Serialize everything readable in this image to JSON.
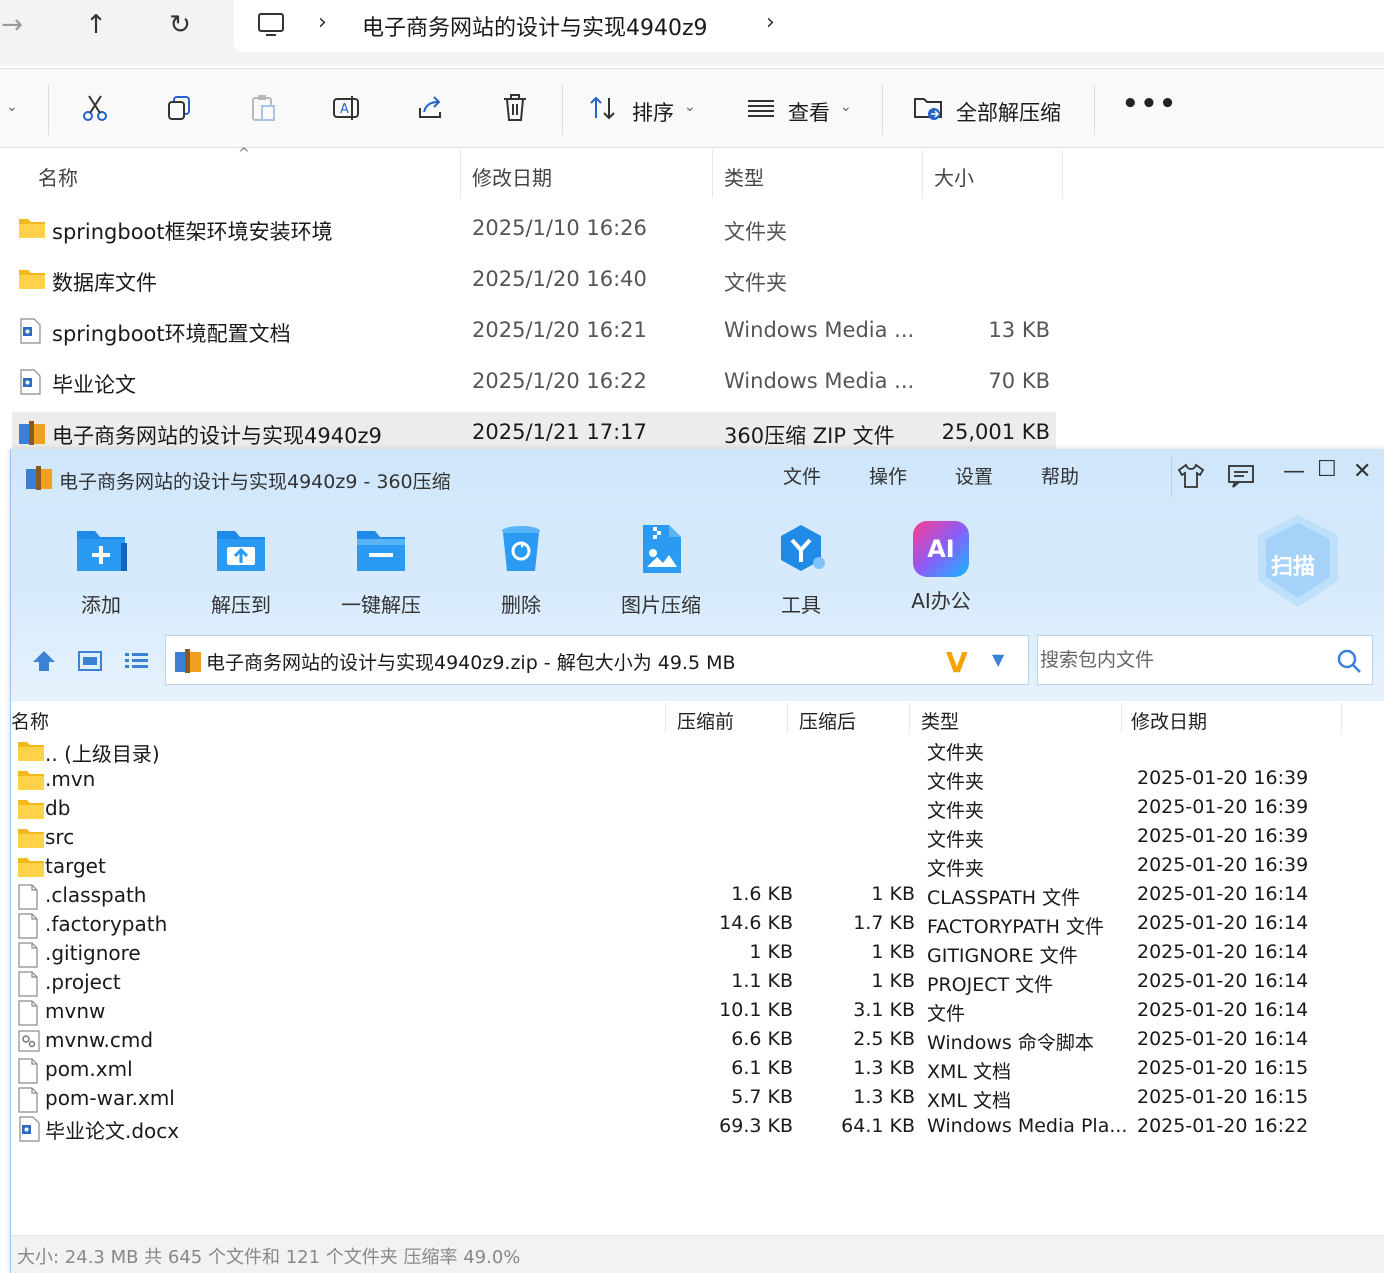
{
  "explorer": {
    "breadcrumb": "电子商务网站的设计与实现4940z9",
    "toolbar": {
      "sort_label": "排序",
      "view_label": "查看",
      "extract_all_label": "全部解压缩",
      "more_label": "•••"
    },
    "columns": {
      "name": "名称",
      "date": "修改日期",
      "type": "类型",
      "size": "大小"
    },
    "files": [
      {
        "name": "springboot框架环境安装环境",
        "date": "2025/1/10 16:26",
        "type": "文件夹",
        "size": "",
        "icon": "folder-icon"
      },
      {
        "name": "数据库文件",
        "date": "2025/1/20 16:40",
        "type": "文件夹",
        "size": "",
        "icon": "folder-icon"
      },
      {
        "name": "springboot环境配置文档",
        "date": "2025/1/20 16:21",
        "type": "Windows Media ...",
        "size": "13 KB",
        "icon": "document-icon"
      },
      {
        "name": "毕业论文",
        "date": "2025/1/20 16:22",
        "type": "Windows Media ...",
        "size": "70 KB",
        "icon": "document-icon"
      },
      {
        "name": "电子商务网站的设计与实现4940z9",
        "date": "2025/1/21 17:17",
        "type": "360压缩 ZIP 文件",
        "size": "25,001 KB",
        "icon": "zip-archive-icon"
      }
    ]
  },
  "zip360": {
    "title": "电子商务网站的设计与实现4940z9 - 360压缩",
    "menu": [
      "文件",
      "操作",
      "设置",
      "帮助"
    ],
    "tools": [
      {
        "label": "添加",
        "icon": "add-folder-icon"
      },
      {
        "label": "解压到",
        "icon": "extract-to-icon"
      },
      {
        "label": "一键解压",
        "icon": "one-click-extract-icon"
      },
      {
        "label": "删除",
        "icon": "recycle-bin-icon"
      },
      {
        "label": "图片压缩",
        "icon": "image-compress-icon"
      },
      {
        "label": "工具",
        "icon": "tools-icon"
      },
      {
        "label": "AI办公",
        "icon": "ai-office-icon"
      }
    ],
    "scan_label": "扫描",
    "ai_badge": "AI",
    "path_text": "电子商务网站的设计与实现4940z9.zip - 解包大小为 49.5 MB",
    "search_placeholder": "搜索包内文件",
    "columns": {
      "name": "名称",
      "before": "压缩前",
      "after": "压缩后",
      "type": "类型",
      "date": "修改日期"
    },
    "rows": [
      {
        "name": ".. (上级目录)",
        "before": "",
        "after": "",
        "type": "文件夹",
        "date": "",
        "icon": "folder-icon"
      },
      {
        "name": ".mvn",
        "before": "",
        "after": "",
        "type": "文件夹",
        "date": "2025-01-20 16:39",
        "icon": "folder-icon"
      },
      {
        "name": "db",
        "before": "",
        "after": "",
        "type": "文件夹",
        "date": "2025-01-20 16:39",
        "icon": "folder-icon"
      },
      {
        "name": "src",
        "before": "",
        "after": "",
        "type": "文件夹",
        "date": "2025-01-20 16:39",
        "icon": "folder-icon"
      },
      {
        "name": "target",
        "before": "",
        "after": "",
        "type": "文件夹",
        "date": "2025-01-20 16:39",
        "icon": "folder-icon"
      },
      {
        "name": ".classpath",
        "before": "1.6 KB",
        "after": "1 KB",
        "type": "CLASSPATH 文件",
        "date": "2025-01-20 16:14",
        "icon": "file-icon"
      },
      {
        "name": ".factorypath",
        "before": "14.6 KB",
        "after": "1.7 KB",
        "type": "FACTORYPATH 文件",
        "date": "2025-01-20 16:14",
        "icon": "file-icon"
      },
      {
        "name": ".gitignore",
        "before": "1 KB",
        "after": "1 KB",
        "type": "GITIGNORE 文件",
        "date": "2025-01-20 16:14",
        "icon": "file-icon"
      },
      {
        "name": ".project",
        "before": "1.1 KB",
        "after": "1 KB",
        "type": "PROJECT 文件",
        "date": "2025-01-20 16:14",
        "icon": "file-icon"
      },
      {
        "name": "mvnw",
        "before": "10.1 KB",
        "after": "3.1 KB",
        "type": "文件",
        "date": "2025-01-20 16:14",
        "icon": "file-icon"
      },
      {
        "name": "mvnw.cmd",
        "before": "6.6 KB",
        "after": "2.5 KB",
        "type": "Windows 命令脚本",
        "date": "2025-01-20 16:14",
        "icon": "script-icon"
      },
      {
        "name": "pom.xml",
        "before": "6.1 KB",
        "after": "1.3 KB",
        "type": "XML 文档",
        "date": "2025-01-20 16:15",
        "icon": "file-icon"
      },
      {
        "name": "pom-war.xml",
        "before": "5.7 KB",
        "after": "1.3 KB",
        "type": "XML 文档",
        "date": "2025-01-20 16:15",
        "icon": "file-icon"
      },
      {
        "name": "毕业论文.docx",
        "before": "69.3 KB",
        "after": "64.1 KB",
        "type": "Windows Media Pla...",
        "date": "2025-01-20 16:22",
        "icon": "document-icon"
      }
    ],
    "status": "大小: 24.3 MB 共 645 个文件和 121 个文件夹 压缩率 49.0%"
  }
}
